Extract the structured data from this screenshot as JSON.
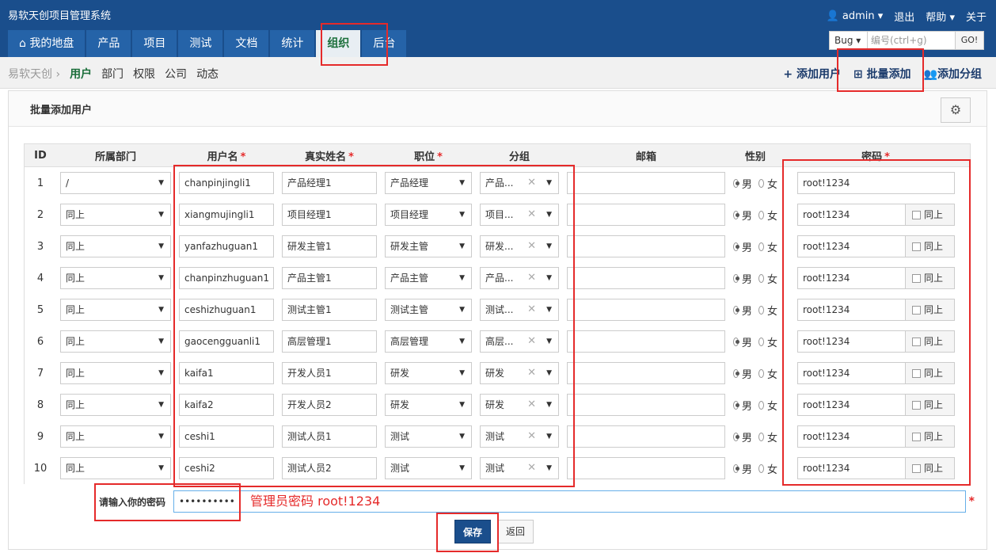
{
  "app_title": "易软天创项目管理系统",
  "top_right": {
    "user": "admin",
    "logout": "退出",
    "help": "帮助",
    "about": "关于"
  },
  "tabs": [
    {
      "label": "⌂ 我的地盘"
    },
    {
      "label": "产品"
    },
    {
      "label": "项目"
    },
    {
      "label": "测试"
    },
    {
      "label": "文档"
    },
    {
      "label": "统计"
    },
    {
      "label": "组织",
      "active": true
    },
    {
      "label": "后台"
    }
  ],
  "search": {
    "type": "Bug",
    "placeholder": "编号(ctrl+g)",
    "go": "GO!"
  },
  "breadcrumb": {
    "root": "易软天创",
    "items": [
      "用户",
      "部门",
      "权限",
      "公司",
      "动态"
    ]
  },
  "actions": {
    "add_user": "+ 添加用户",
    "batch_add": "批量添加",
    "add_group": "添加分组"
  },
  "panel": {
    "title": "批量添加用户"
  },
  "columns": [
    "ID",
    "所属部门",
    "用户名",
    "真实姓名",
    "职位",
    "分组",
    "邮箱",
    "性别",
    "密码"
  ],
  "gender": {
    "male": "男",
    "female": "女"
  },
  "same_label": "同上",
  "rows": [
    {
      "id": "1",
      "dept": "/",
      "username": "chanpinjingli1",
      "realname": "产品经理1",
      "role": "产品经理",
      "group": "产品...",
      "password": "root!1234"
    },
    {
      "id": "2",
      "dept": "同上",
      "username": "xiangmujingli1",
      "realname": "项目经理1",
      "role": "项目经理",
      "group": "项目...",
      "password": "root!1234"
    },
    {
      "id": "3",
      "dept": "同上",
      "username": "yanfazhuguan1",
      "realname": "研发主管1",
      "role": "研发主管",
      "group": "研发...",
      "password": "root!1234"
    },
    {
      "id": "4",
      "dept": "同上",
      "username": "chanpinzhuguan1",
      "realname": "产品主管1",
      "role": "产品主管",
      "group": "产品...",
      "password": "root!1234"
    },
    {
      "id": "5",
      "dept": "同上",
      "username": "ceshizhuguan1",
      "realname": "测试主管1",
      "role": "测试主管",
      "group": "测试...",
      "password": "root!1234"
    },
    {
      "id": "6",
      "dept": "同上",
      "username": "gaocengguanli1",
      "realname": "高层管理1",
      "role": "高层管理",
      "group": "高层...",
      "password": "root!1234"
    },
    {
      "id": "7",
      "dept": "同上",
      "username": "kaifa1",
      "realname": "开发人员1",
      "role": "研发",
      "group": "研发",
      "password": "root!1234"
    },
    {
      "id": "8",
      "dept": "同上",
      "username": "kaifa2",
      "realname": "开发人员2",
      "role": "研发",
      "group": "研发",
      "password": "root!1234"
    },
    {
      "id": "9",
      "dept": "同上",
      "username": "ceshi1",
      "realname": "测试人员1",
      "role": "测试",
      "group": "测试",
      "password": "root!1234"
    },
    {
      "id": "10",
      "dept": "同上",
      "username": "ceshi2",
      "realname": "测试人员2",
      "role": "测试",
      "group": "测试",
      "password": "root!1234"
    }
  ],
  "verify": {
    "label": "请输入你的密码",
    "value": "••••••••••",
    "note": "管理员密码 root!1234"
  },
  "buttons": {
    "save": "保存",
    "back": "返回"
  }
}
